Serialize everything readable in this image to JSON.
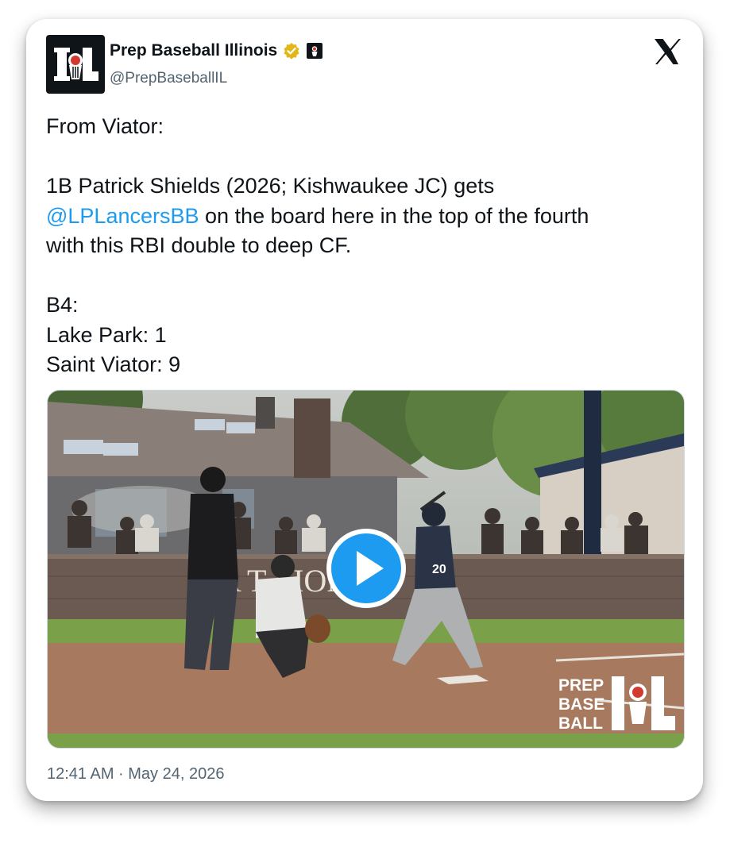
{
  "account": {
    "display_name": "Prep Baseball Illinois",
    "handle": "@PrepBaseballIL",
    "verified_badge_icon": "gold-verified-badge-icon",
    "affiliate_badge_icon": "prep-baseball-affiliate-icon",
    "avatar_logo": "IL"
  },
  "platform_logo": "x-logo-icon",
  "tweet": {
    "line1": "From Viator:",
    "line2_start": "1B Patrick Shields (2026; Kishwaukee JC) gets",
    "mention": "@LPLancersBB",
    "line3_rest": " on the board here in the top of the fourth",
    "line4": "with this RBI double to deep CF.",
    "line5": "B4:",
    "line6": "Lake Park: 1",
    "line7": "Saint Viator: 9"
  },
  "media": {
    "wall_text": "A    T        LIONS",
    "watermark_lines": [
      "PREP",
      "BASE",
      "BALL"
    ],
    "watermark_logo": "IL",
    "player_number": "20",
    "play_icon": "play-button-icon"
  },
  "timestamp": "12:41 AM · May 24, 2026",
  "colors": {
    "link": "#1d9bf0",
    "text": "#0f1419",
    "secondary": "#536471",
    "play_button": "#1d9bf0"
  }
}
